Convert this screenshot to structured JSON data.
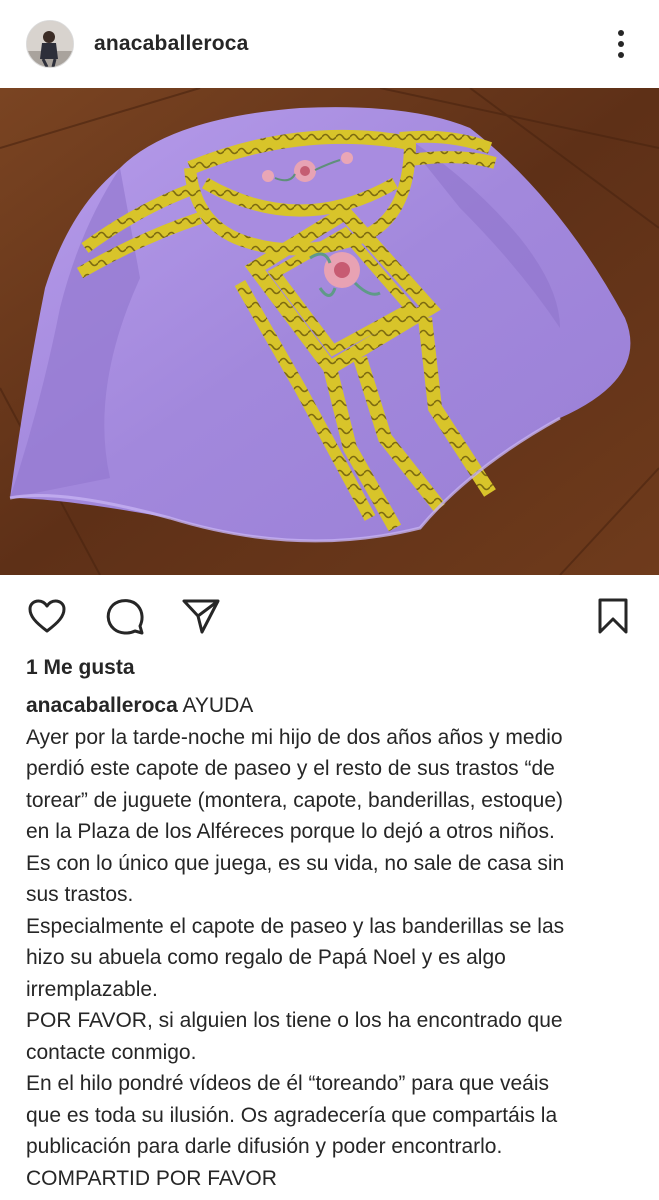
{
  "post": {
    "username": "anacaballeroca",
    "likes_text": "1 Me gusta"
  },
  "caption": {
    "username": "anacaballeroca",
    "first_text": "AYUDA",
    "lines": [
      "Ayer por la tarde-noche mi hijo de dos años años y medio",
      "perdió este capote de paseo y el resto de sus trastos “de",
      "torear” de juguete (montera, capote, banderillas, estoque)",
      "en la Plaza de los Alféreces porque lo dejó a otros niños.",
      "Es con lo único que juega, es su vida, no sale de casa sin",
      "sus trastos.",
      "Especialmente el capote de paseo y las banderillas se las",
      "hizo su abuela como regalo de Papá Noel y es algo",
      "irremplazable.",
      "POR FAVOR, si alguien los tiene o los ha encontrado que",
      "contacte conmigo.",
      "En el hilo pondré vídeos de él “toreando” para que veáis",
      "que es toda su ilusión. Os agradecería que compartáis la",
      "publicación para darle difusión y poder encontrarlo.",
      "COMPARTID POR FAVOR"
    ]
  },
  "icons": {
    "more": "more-vertical-icon",
    "like": "heart-icon",
    "comment": "comment-icon",
    "share": "send-icon",
    "save": "bookmark-icon"
  },
  "colors": {
    "text": "#262626",
    "cape": "#a88ce0",
    "trim": "#d9c52a",
    "floor": "#6b3a1c"
  }
}
